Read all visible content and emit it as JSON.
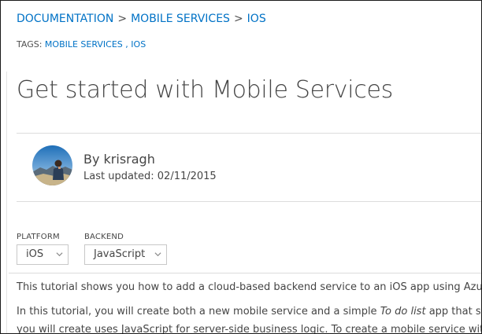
{
  "breadcrumb": {
    "items": [
      "DOCUMENTATION",
      "MOBILE SERVICES",
      "IOS"
    ],
    "separator": ">"
  },
  "tags": {
    "label": "TAGS:",
    "items": [
      "MOBILE SERVICES",
      "IOS"
    ],
    "separator": ","
  },
  "article": {
    "title": "Get started with Mobile Services"
  },
  "author": {
    "name": "By krisragh",
    "updated": "Last updated: 02/11/2015"
  },
  "selectors": {
    "platform": {
      "label": "PLATFORM",
      "value": "iOS"
    },
    "backend": {
      "label": "BACKEND",
      "value": "JavaScript"
    }
  },
  "body": {
    "p1": "This tutorial shows you how to add a cloud-based backend service to an iOS app using Azure M",
    "p2_before": "In this tutorial, you will create both a new mobile service and a simple ",
    "p2_em": "To do list",
    "p2_after": " app that stores",
    "p3": "you will create uses JavaScript for server-side business logic. To create a mobile service with serv"
  },
  "colors": {
    "link": "#0072c6",
    "text": "#454545",
    "rule": "#dcdcdc"
  },
  "icons": {
    "avatar": "author-photo",
    "dropdown": "chevron-down-icon"
  }
}
